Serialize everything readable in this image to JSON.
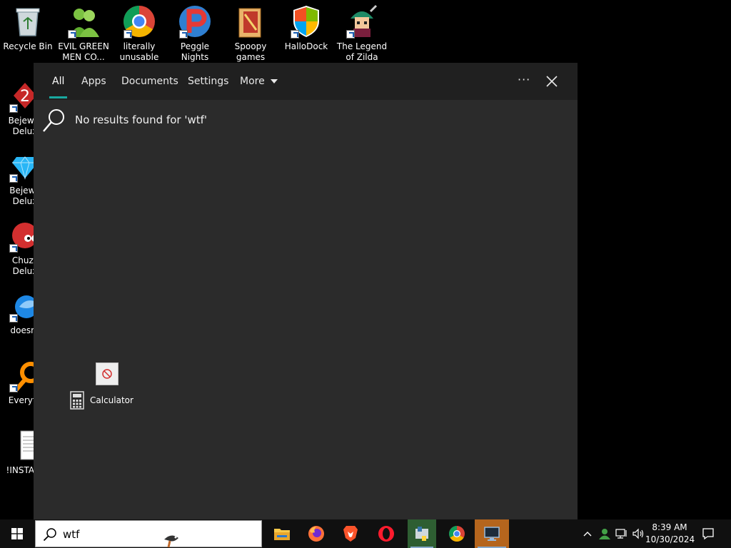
{
  "desktop": {
    "icons": [
      {
        "label": "Recycle Bin"
      },
      {
        "label": "EVIL GREEN\nMEN CO..."
      },
      {
        "label": "literally\nunusable"
      },
      {
        "label": "Peggle Nights\nDeluxe"
      },
      {
        "label": "Spoopy\ngames"
      },
      {
        "label": "HalloDock"
      },
      {
        "label": "The Legend\nof Zilda"
      },
      {
        "label": "Bejewel\nDelux"
      },
      {
        "label": "Bejewe\nDelux"
      },
      {
        "label": "Chuzz\nDelux"
      },
      {
        "label": "doesnt"
      },
      {
        "label": "Everyth"
      },
      {
        "label": "!INSTALL"
      }
    ]
  },
  "search_panel": {
    "tabs": [
      {
        "label": "All"
      },
      {
        "label": "Apps"
      },
      {
        "label": "Documents"
      },
      {
        "label": "Settings"
      },
      {
        "label": "More"
      }
    ],
    "more_options_label": "···",
    "no_results_text": "No results found for 'wtf'"
  },
  "drag": {
    "item_label": "Calculator"
  },
  "taskbar": {
    "search_query": "wtf",
    "clock": {
      "time": "8:39 AM",
      "date": "10/30/2024"
    }
  },
  "colors": {
    "accent": "#19a9a0",
    "panel_bg": "#2b2b2b",
    "header_bg": "#202020",
    "taskbar_bg": "#101010"
  }
}
